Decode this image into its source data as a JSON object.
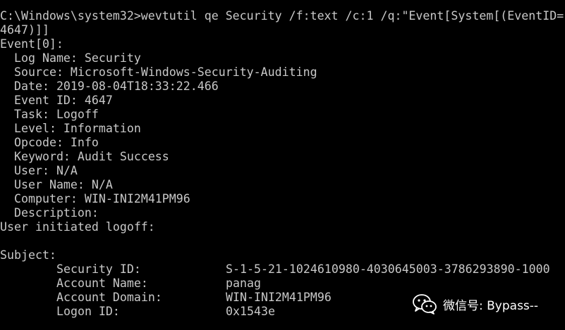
{
  "console": {
    "command_line_1": "C:\\Windows\\system32>wevtutil qe Security /f:text /c:1 /q:\"Event[System[(EventID=",
    "command_line_2": "4647)]]",
    "event_header": "Event[0]:",
    "fields": {
      "log_name": "Log Name: Security",
      "source": "Source: Microsoft-Windows-Security-Auditing",
      "date": "Date: 2019-08-04T18:33:22.466",
      "event_id": "Event ID: 4647",
      "task": "Task: Logoff",
      "level": "Level: Information",
      "opcode": "Opcode: Info",
      "keyword": "Keyword: Audit Success",
      "user": "User: N/A",
      "user_name": "User Name: N/A",
      "computer": "Computer: WIN-INI2M41PM96",
      "description": "Description:"
    },
    "message": "User initiated logoff:",
    "subject_header": "Subject:",
    "subject": {
      "security_id_label": "Security ID:",
      "security_id_value": "S-1-5-21-1024610980-4030645003-3786293890-1000",
      "account_name_label": "Account Name:",
      "account_name_value": "panag",
      "account_domain_label": "Account Domain:",
      "account_domain_value": "WIN-INI2M41PM96",
      "logon_id_label": "Logon ID:",
      "logon_id_value": "0x1543e"
    }
  },
  "watermark": {
    "text": "微信号: Bypass--",
    "icon": "wechat-icon"
  },
  "colors": {
    "background": "#000000",
    "text": "#c8c8c8"
  }
}
